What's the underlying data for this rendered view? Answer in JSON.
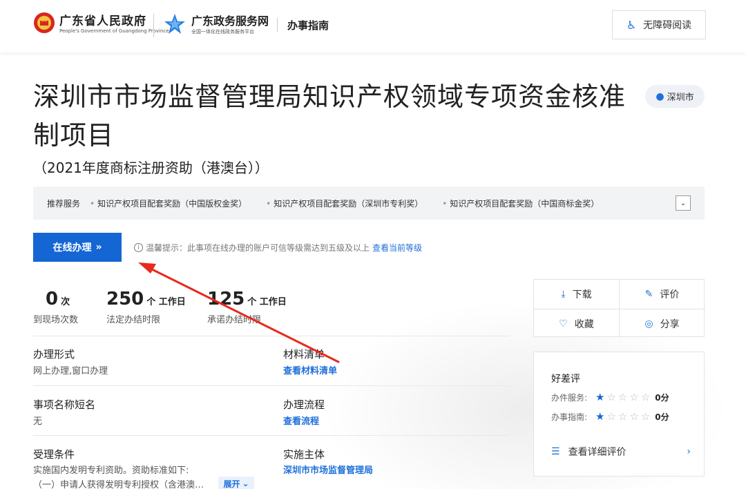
{
  "header": {
    "gov_title": "广东省人民政府",
    "gov_subtitle": "People's Government of Guangdong Province",
    "service_title": "广东政务服务网",
    "service_subtitle": "全国一体化在线政务服务平台",
    "guide_label": "办事指南",
    "accessibility_label": "无障碍阅读"
  },
  "page": {
    "title": "深圳市市场监督管理局知识产权领域专项资金核准制项目",
    "subtitle": "（2021年度商标注册资助（港澳台））",
    "location": "深圳市"
  },
  "recommend": {
    "label": "推荐服务",
    "items": [
      "知识产权项目配套奖励（中国版权金奖）",
      "知识产权项目配套奖励（深圳市专利奖）",
      "知识产权项目配套奖励（中国商标金奖）"
    ]
  },
  "online": {
    "button_label": "在线办理",
    "tip_text": "温馨提示：此事项在线办理的账户可信等级需达到五级及以上",
    "tip_link": "查看当前等级"
  },
  "stats": [
    {
      "value": "0",
      "unit": "次",
      "caption": "到现场次数"
    },
    {
      "value": "250",
      "unit": "个 工作日",
      "caption": "法定办结时限"
    },
    {
      "value": "125",
      "unit": "个 工作日",
      "caption": "承诺办结时限"
    }
  ],
  "fields": {
    "form_title": "办理形式",
    "form_value": "网上办理,窗口办理",
    "materials_title": "材料清单",
    "materials_link": "查看材料清单",
    "shortname_title": "事项名称短名",
    "shortname_value": "无",
    "process_title": "办理流程",
    "process_link": "查看流程",
    "conditions_title": "受理条件",
    "conditions_line1": "实施国内发明专利资助。资助标准如下:",
    "conditions_line2": "（一）申请人获得发明专利授权（含港澳…",
    "expand_label": "展开",
    "entity_title": "实施主体",
    "entity_link": "深圳市市场监督管理局"
  },
  "actions": {
    "download": "下载",
    "evaluate": "评价",
    "favorite": "收藏",
    "share": "分享"
  },
  "rating": {
    "title": "好差评",
    "service_label": "办件服务:",
    "service_stars": 1,
    "service_score": "0分",
    "guide_label": "办事指南:",
    "guide_stars": 1,
    "guide_score": "0分",
    "detail_link": "查看详细评价"
  },
  "colors": {
    "primary": "#1466d4",
    "link": "#1e6fd9",
    "annotation": "#e8291c"
  }
}
